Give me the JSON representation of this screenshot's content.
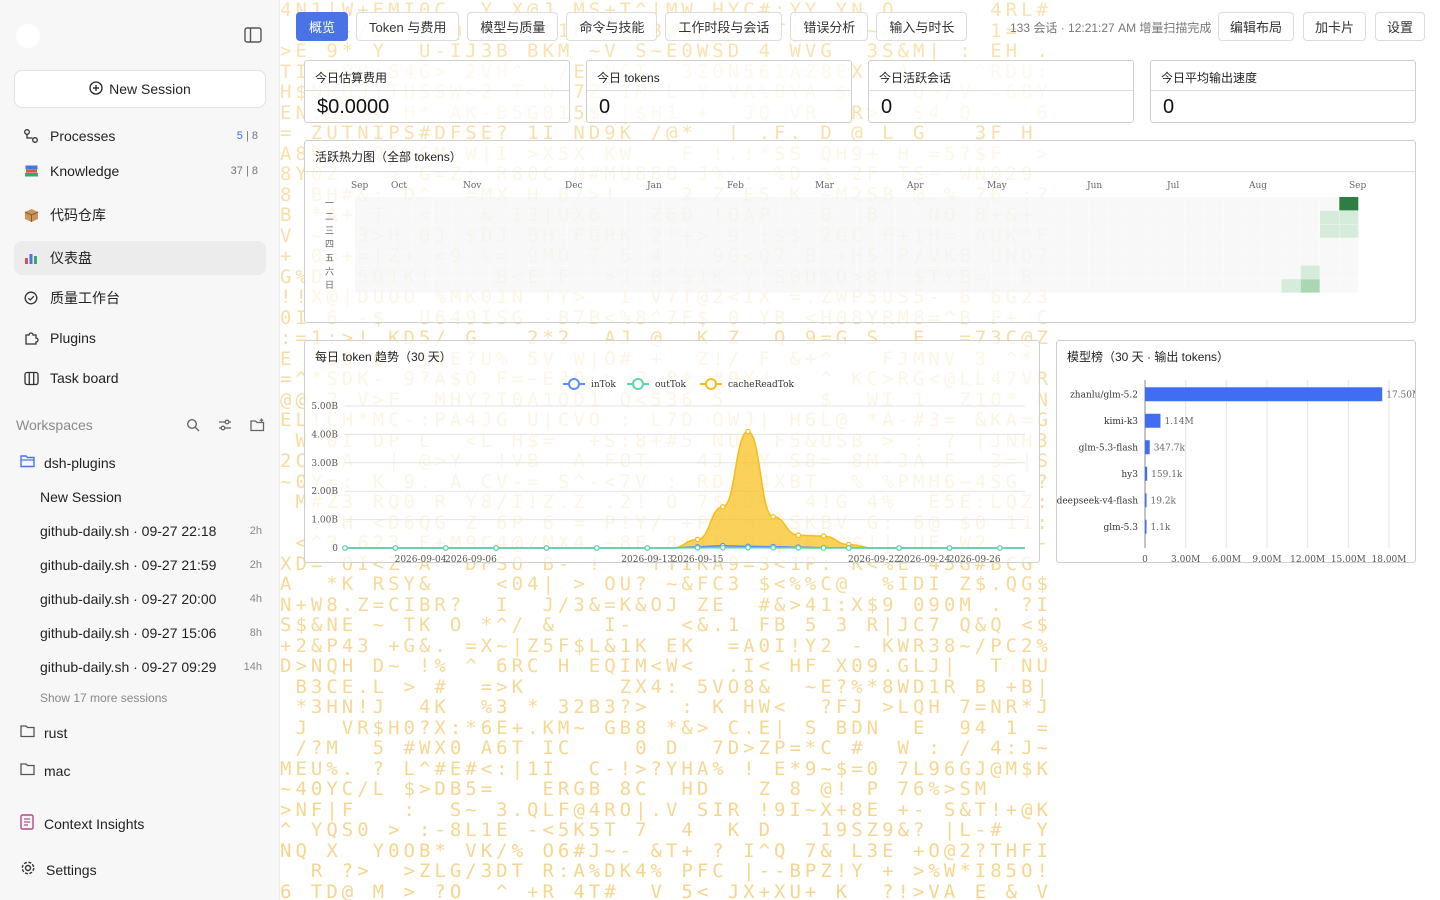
{
  "sidebar": {
    "new_session": "New Session",
    "nav": [
      {
        "label": "Processes",
        "count_hl": "5",
        "count_rest": " | 8"
      },
      {
        "label": "Knowledge",
        "count": "37 | 8"
      },
      {
        "label": "代码仓库"
      },
      {
        "label": "仪表盘"
      },
      {
        "label": "质量工作台"
      },
      {
        "label": "Plugins"
      },
      {
        "label": "Task board"
      }
    ],
    "workspaces_label": "Workspaces",
    "workspaces": [
      {
        "name": "dsh-plugins",
        "sessions": [
          {
            "title": "New Session",
            "age": ""
          },
          {
            "title": "github-daily.sh · 09-27 22:18",
            "age": "2h"
          },
          {
            "title": "github-daily.sh · 09-27 21:59",
            "age": "2h"
          },
          {
            "title": "github-daily.sh · 09-27 20:00",
            "age": "4h"
          },
          {
            "title": "github-daily.sh · 09-27 15:06",
            "age": "8h"
          },
          {
            "title": "github-daily.sh · 09-27 09:29",
            "age": "14h"
          }
        ],
        "show_more": "Show 17 more sessions"
      },
      {
        "name": "rust"
      },
      {
        "name": "mac"
      }
    ],
    "bottom": [
      {
        "label": "Context Insights"
      },
      {
        "label": "Settings"
      }
    ]
  },
  "tabs": [
    "概览",
    "Token 与费用",
    "模型与质量",
    "命令与技能",
    "工作时段与会话",
    "错误分析",
    "输入与时长"
  ],
  "active_tab": 0,
  "status": "133 会话 · 12:21:27 AM 增量扫描完成",
  "right_buttons": [
    "编辑布局",
    "加卡片",
    "设置"
  ],
  "kpis": [
    {
      "label": "今日估算费用",
      "value": "$0.0000"
    },
    {
      "label": "今日 tokens",
      "value": "0"
    },
    {
      "label": "今日活跃会话",
      "value": "0"
    },
    {
      "label": "今日平均输出速度",
      "value": "0"
    }
  ],
  "heatmap": {
    "title": "活跃热力图（全部 tokens）",
    "months": [
      "Sep",
      "Oct",
      "Nov",
      "Dec",
      "Jan",
      "Feb",
      "Mar",
      "Apr",
      "May",
      "Jun",
      "Jul",
      "Aug",
      "Sep"
    ],
    "weekdays": [
      "一",
      "二",
      "三",
      "四",
      "五",
      "六",
      "日"
    ]
  },
  "trend": {
    "title": "每日 token 趋势（30 天）"
  },
  "ranking": {
    "title": "模型榜（30 天 · 输出 tokens）"
  },
  "colors": {
    "accent": "#4a74e6",
    "inTok": "#5b8ff9",
    "outTok": "#5ad8a6",
    "cacheReadTok": "#f6bd16",
    "bar": "#3f6ff0",
    "heat_dark": "#2e7d43",
    "heat_light": "#cfe9d4"
  },
  "chart_data": [
    {
      "type": "area",
      "title": "每日 token 趋势（30 天）",
      "xlabel": "",
      "ylabel": "",
      "x": [
        "2026-09-01",
        "2026-09-02",
        "2026-09-03",
        "2026-09-04",
        "2026-09-05",
        "2026-09-06",
        "2026-09-07",
        "2026-09-08",
        "2026-09-09",
        "2026-09-10",
        "2026-09-11",
        "2026-09-12",
        "2026-09-13",
        "2026-09-14",
        "2026-09-15",
        "2026-09-16",
        "2026-09-17",
        "2026-09-18",
        "2026-09-19",
        "2026-09-20",
        "2026-09-21",
        "2026-09-22",
        "2026-09-23",
        "2026-09-24",
        "2026-09-25",
        "2026-09-26",
        "2026-09-27",
        "2026-09-28"
      ],
      "x_tick_labels": [
        "2026-09-04",
        "2026-09-06",
        "2026-09-13",
        "2026-09-15",
        "2026-09-22",
        "2026-09-24",
        "2026-09-26"
      ],
      "y_tick_labels": [
        "0",
        "1.00B",
        "2.00B",
        "3.00B",
        "4.00B",
        "5.00B"
      ],
      "ylim": [
        0,
        5000000000
      ],
      "legend_position": "top",
      "series": [
        {
          "name": "inTok",
          "values": [
            0,
            0,
            0,
            0,
            0,
            0,
            0,
            0,
            0,
            0,
            0,
            0,
            0,
            0,
            40000000,
            80000000,
            60000000,
            50000000,
            30000000,
            10000000,
            5000000,
            0,
            0,
            0,
            0,
            0,
            0,
            0
          ]
        },
        {
          "name": "outTok",
          "values": [
            0,
            0,
            0,
            0,
            0,
            0,
            0,
            0,
            0,
            0,
            0,
            0,
            0,
            0,
            5000000,
            10000000,
            8000000,
            6000000,
            3000000,
            1000000,
            500000,
            0,
            0,
            0,
            0,
            0,
            0,
            0
          ]
        },
        {
          "name": "cacheReadTok",
          "values": [
            0,
            0,
            0,
            0,
            0,
            0,
            0,
            0,
            0,
            0,
            0,
            0,
            0,
            0,
            300000000,
            1450000000,
            4100000000,
            1100000000,
            450000000,
            420000000,
            120000000,
            0,
            0,
            0,
            0,
            0,
            0,
            0
          ]
        }
      ]
    },
    {
      "type": "bar",
      "orientation": "horizontal",
      "title": "模型榜（30 天 · 输出 tokens）",
      "categories": [
        "zhanlu/glm-5.2",
        "kimi-k3",
        "glm-5.3-flash",
        "hy3",
        "deepseek-v4-flash",
        "glm-5.3"
      ],
      "values": [
        17500000,
        1140000,
        347700,
        159100,
        19200,
        1100
      ],
      "data_labels": [
        "17.50M",
        "1.14M",
        "347.7k",
        "159.1k",
        "19.2k",
        "1.1k"
      ],
      "x_tick_labels": [
        "0",
        "3.00M",
        "6.00M",
        "9.00M",
        "12.00M",
        "15.00M",
        "18.00M"
      ],
      "xlim": [
        0,
        18000000
      ]
    },
    {
      "type": "heatmap",
      "title": "活跃热力图（全部 tokens）",
      "x_labels": [
        "Sep",
        "Oct",
        "Nov",
        "Dec",
        "Jan",
        "Feb",
        "Mar",
        "Apr",
        "May",
        "Jun",
        "Jul",
        "Aug",
        "Sep"
      ],
      "y_labels": [
        "一",
        "二",
        "三",
        "四",
        "五",
        "六",
        "日"
      ],
      "active_cells": [
        {
          "week": 51,
          "day": 0,
          "level": 4
        },
        {
          "week": 51,
          "day": 1,
          "level": 1
        },
        {
          "week": 50,
          "day": 1,
          "level": 1
        },
        {
          "week": 51,
          "day": 2,
          "level": 1
        },
        {
          "week": 50,
          "day": 2,
          "level": 1
        },
        {
          "week": 49,
          "day": 5,
          "level": 1
        },
        {
          "week": 48,
          "day": 6,
          "level": 1
        },
        {
          "week": 49,
          "day": 6,
          "level": 2
        }
      ]
    }
  ]
}
